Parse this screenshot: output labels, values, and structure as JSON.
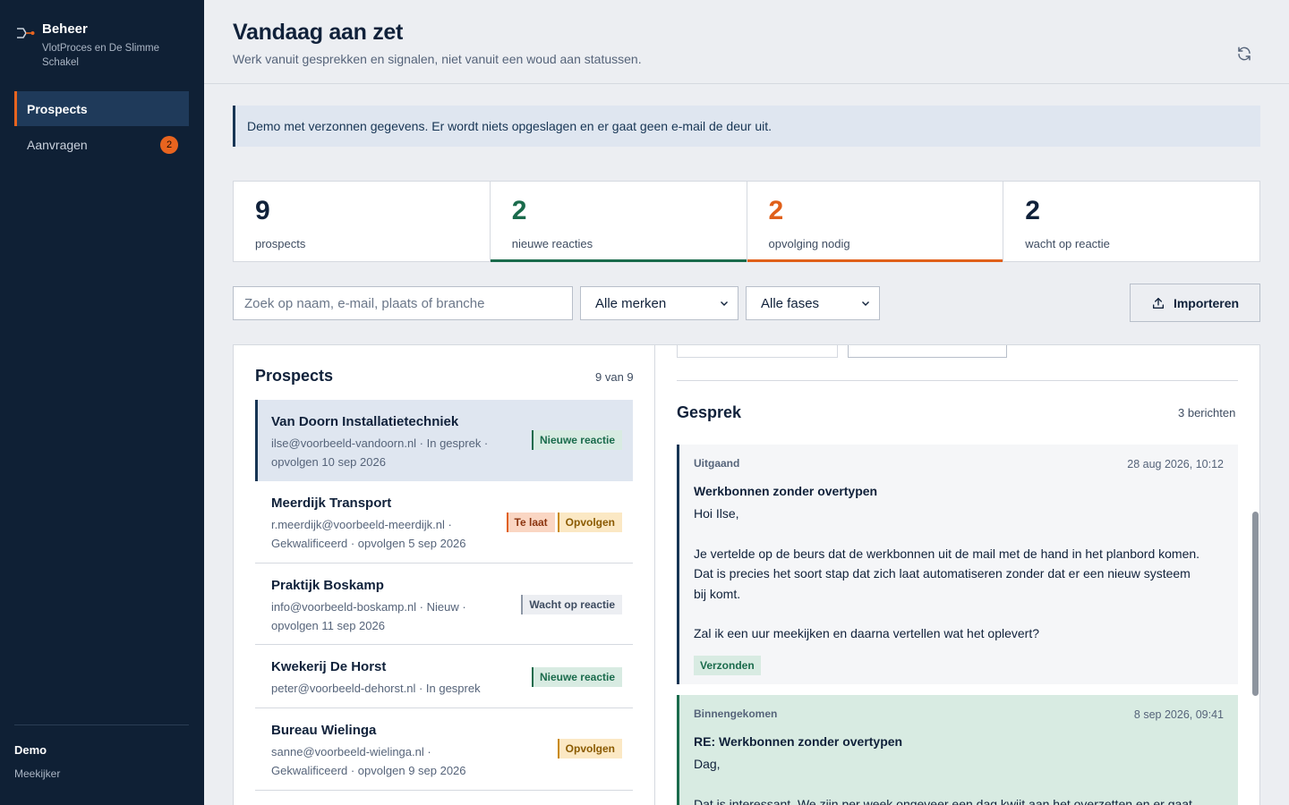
{
  "sidebar": {
    "brand_title": "Beheer",
    "brand_subtitle": "VlotProces en De Slimme Schakel",
    "nav": [
      {
        "label": "Prospects",
        "active": true
      },
      {
        "label": "Aanvragen",
        "badge": "2"
      }
    ],
    "user_name": "Demo",
    "user_role": "Meekijker"
  },
  "header": {
    "title": "Vandaag aan zet",
    "subtitle": "Werk vanuit gesprekken en signalen, niet vanuit een woud aan statussen.",
    "refresh_icon": "refresh-icon"
  },
  "banner": "Demo met verzonnen gegevens. Er wordt niets opgeslagen en er gaat geen e-mail de deur uit.",
  "stats": [
    {
      "value": "9",
      "label": "prospects"
    },
    {
      "value": "2",
      "label": "nieuwe reacties",
      "accent": "#1a6b4c"
    },
    {
      "value": "2",
      "label": "opvolging nodig",
      "accent": "#e0601a"
    },
    {
      "value": "2",
      "label": "wacht op reactie"
    }
  ],
  "filters": {
    "search_placeholder": "Zoek op naam, e-mail, plaats of branche",
    "brand_select": "Alle merken",
    "phase_select": "Alle fases",
    "import_label": "Importeren"
  },
  "prospects": {
    "title": "Prospects",
    "count": "9 van 9",
    "rows": [
      {
        "name": "Van Doorn Installatietechniek",
        "meta": "ilse@voorbeeld-vandoorn.nl · In gesprek · opvolgen 10 sep 2026",
        "tags": [
          "Nieuwe reactie"
        ]
      },
      {
        "name": "Meerdijk Transport",
        "meta": "r.meerdijk@voorbeeld-meerdijk.nl · Gekwalificeerd · opvolgen 5 sep 2026",
        "tags": [
          "Te laat",
          "Opvolgen"
        ]
      },
      {
        "name": "Praktijk Boskamp",
        "meta": "info@voorbeeld-boskamp.nl · Nieuw · opvolgen 11 sep 2026",
        "tags": [
          "Wacht op reactie"
        ]
      },
      {
        "name": "Kwekerij De Horst",
        "meta": "peter@voorbeeld-dehorst.nl · In gesprek",
        "tags": [
          "Nieuwe reactie"
        ]
      },
      {
        "name": "Bureau Wielinga",
        "meta": "sanne@voorbeeld-wielinga.nl · Gekwalificeerd · opvolgen 9 sep 2026",
        "tags": [
          "Opvolgen"
        ]
      }
    ]
  },
  "conversation": {
    "title": "Gesprek",
    "count": "3 berichten",
    "messages": [
      {
        "direction": "Uitgaand",
        "date": "28 aug 2026, 10:12",
        "subject": "Werkbonnen zonder overtypen",
        "body": [
          "Hoi Ilse,",
          "Je vertelde op de beurs dat de werkbonnen uit de mail met de hand in het planbord komen. Dat is precies het soort stap dat zich laat automatiseren zonder dat er een nieuw systeem bij komt.",
          "Zal ik een uur meekijken en daarna vertellen wat het oplevert?"
        ],
        "status": "Verzonden"
      },
      {
        "direction": "Binnengekomen",
        "date": "8 sep 2026, 09:41",
        "subject": "RE: Werkbonnen zonder overtypen",
        "body": [
          "Dag,",
          "Dat is interessant. We zijn per week ongeveer een dag kwijt aan het overzetten en er gaat"
        ]
      }
    ]
  },
  "colors": {
    "sidebar_bg": "#0f2035",
    "accent_orange": "#e0601a",
    "accent_green": "#1a6b4c",
    "navy": "#173554"
  }
}
